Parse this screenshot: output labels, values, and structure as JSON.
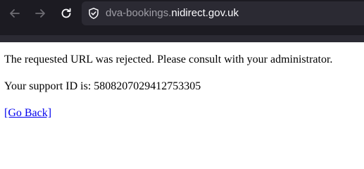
{
  "browser": {
    "url_subdomain": "dva-bookings.",
    "url_domain": "nidirect.gov.uk",
    "icons": {
      "back": "arrow-left-icon",
      "forward": "arrow-right-icon",
      "reload": "reload-icon",
      "security": "shield-icon"
    },
    "colors": {
      "toolbar": "#1c1b22",
      "urlbar": "#2b2a33"
    }
  },
  "page": {
    "message": "The requested URL was rejected. Please consult with your administrator.",
    "support_label": "Your support ID is: 5808207029412753305",
    "go_back_link": "[Go Back]"
  }
}
